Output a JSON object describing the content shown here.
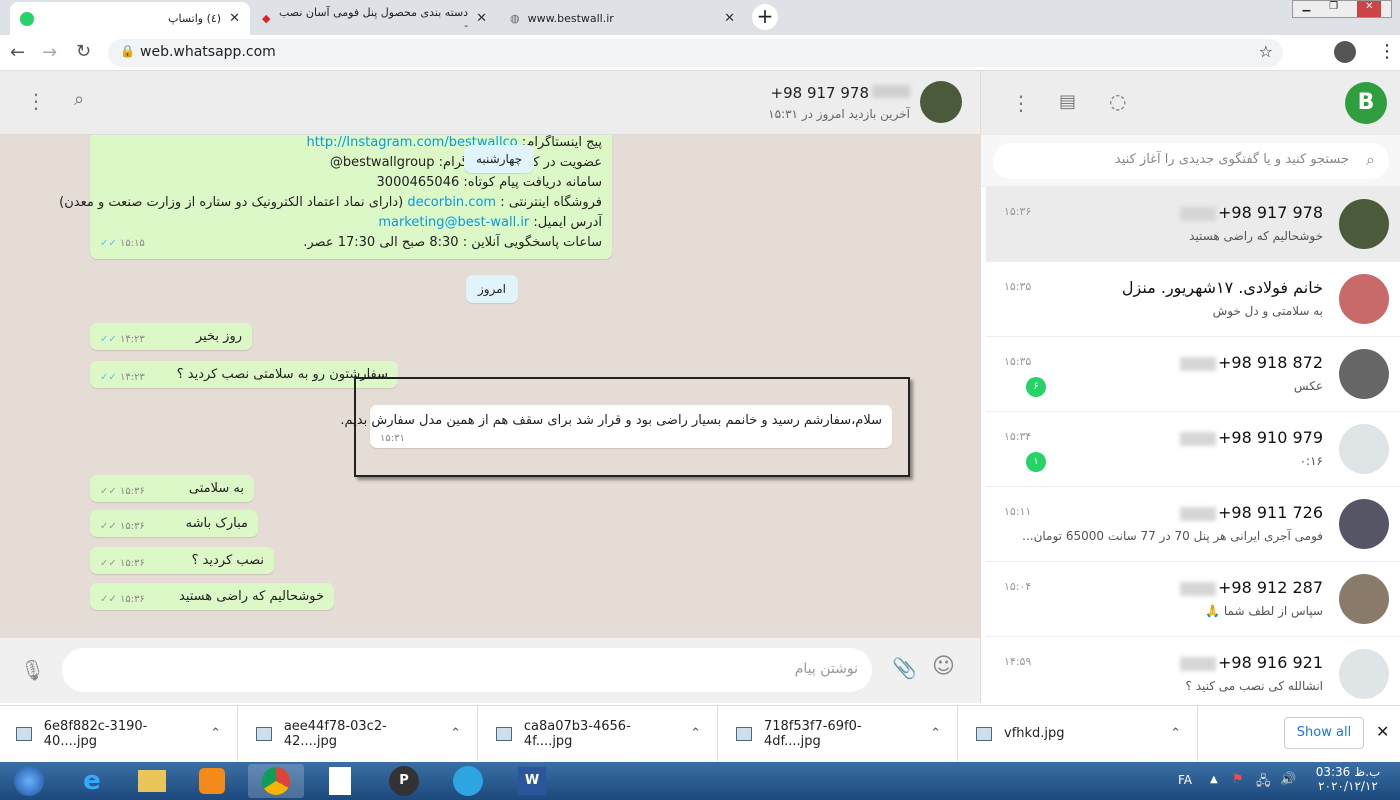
{
  "browser": {
    "tabs": [
      {
        "title": "(٤) واتساپ",
        "active": true
      },
      {
        "title": "دسته بندی محصول پنل فومی آسان نصب -"
      },
      {
        "title": "www.bestwall.ir"
      }
    ],
    "url": "web.whatsapp.com"
  },
  "chat": {
    "contact": "+98 917 978",
    "last_seen": "آخرین بازدید امروز در ۱۵:۳۱",
    "info_message": {
      "lines": [
        {
          "label": "پیج اینستاگرام: ",
          "link": "http://Instagram.com/bestwallco"
        },
        {
          "label": "عضویت در کانال ما در تلگرام: ",
          "text": "bestwallgroup@"
        },
        {
          "label": "سامانه دریافت پیام کوتاه: ",
          "text": "3000465046"
        },
        {
          "label": "فروشگاه اینترنتی : ",
          "link": "decorbin.com",
          "text": " (دارای نماد اعتماد الکترونیک دو ستاره از وزارت صنعت و معدن)"
        },
        {
          "label": "آدرس ایمیل: ",
          "link": "marketing@best-wall.ir"
        },
        {
          "label": "ساعات پاسخگویی آنلاین : 8:30 صبح الی 17:30 عصر."
        }
      ],
      "time": "۱۵:۱۵"
    },
    "date_wed": "چهارشنبه",
    "date_today": "امروز",
    "messages": [
      {
        "text": "روز بخیر",
        "time": "۱۴:۲۳"
      },
      {
        "text": "سفارشتون رو به سلامتی نصب کردید ؟",
        "time": "۱۴:۲۳"
      },
      {
        "text": "به سلامتی",
        "time": "۱۵:۳۶"
      },
      {
        "text": "مبارک باشه",
        "time": "۱۵:۳۶"
      },
      {
        "text": "نصب کردید ؟",
        "time": "۱۵:۳۶"
      },
      {
        "text": "خوشحالیم که راضی هستید",
        "time": "۱۵:۳۶"
      }
    ],
    "incoming": {
      "text": "سلام،سفارشم رسید و خانمم بسیار راضی بود و قرار شد برای سقف هم از همین مدل سفارش بدیم.",
      "time": "۱۵:۳۱"
    },
    "compose_placeholder": "نوشتن پیام"
  },
  "sidebar": {
    "search_placeholder": "جستجو کنید و یا گفتگوی جدیدی را آغاز کنید",
    "chats": [
      {
        "name": "+98 917 978",
        "preview": "خوشحالیم که راضی هستید",
        "time": "۱۵:۳۶",
        "selected": true,
        "avatar": "#4a5a3a"
      },
      {
        "name": "خانم فولادی. ۱۷شهریور. منزل",
        "preview": "به سلامتی و دل خوش",
        "time": "۱۵:۳۵",
        "avatar": "#c96a6a"
      },
      {
        "name": "+98 918 872",
        "preview": "عکس",
        "time": "۱۵:۳۵",
        "badge": "۶",
        "avatar": "#666"
      },
      {
        "name": "+98 910 979",
        "preview": "۰:۱۶",
        "time": "۱۵:۳۴",
        "badge": "۱",
        "avatar": "#dfe5e7"
      },
      {
        "name": "+98 911 726",
        "preview": "فومی آجری ایرانی هر پنل 70 در 77 سانت 65000 تومان...",
        "time": "۱۵:۱۱",
        "avatar": "#556"
      },
      {
        "name": "+98 912 287",
        "preview": "سپاس از لطف شما 🙏",
        "time": "۱۵:۰۴",
        "avatar": "#8a7a6a"
      },
      {
        "name": "+98 916 921",
        "preview": "انشالله کی نصب می کنید ؟",
        "time": "۱۴:۵۹",
        "avatar": "#dfe5e7"
      }
    ]
  },
  "downloads": {
    "items": [
      "6e8f882c-3190-40....jpg",
      "aee44f78-03c2-42....jpg",
      "ca8a07b3-4656-4f....jpg",
      "718f53f7-69f0-4df....jpg",
      "vfhkd.jpg"
    ],
    "show_all": "Show all"
  },
  "taskbar": {
    "lang": "FA",
    "time": "03:36 ب.ظ",
    "date": "۲۰۲۰/۱۲/۱۲"
  },
  "colors": {
    "outgoing": "#dcf8c6",
    "unread": "#25d366",
    "link": "#039be5"
  }
}
